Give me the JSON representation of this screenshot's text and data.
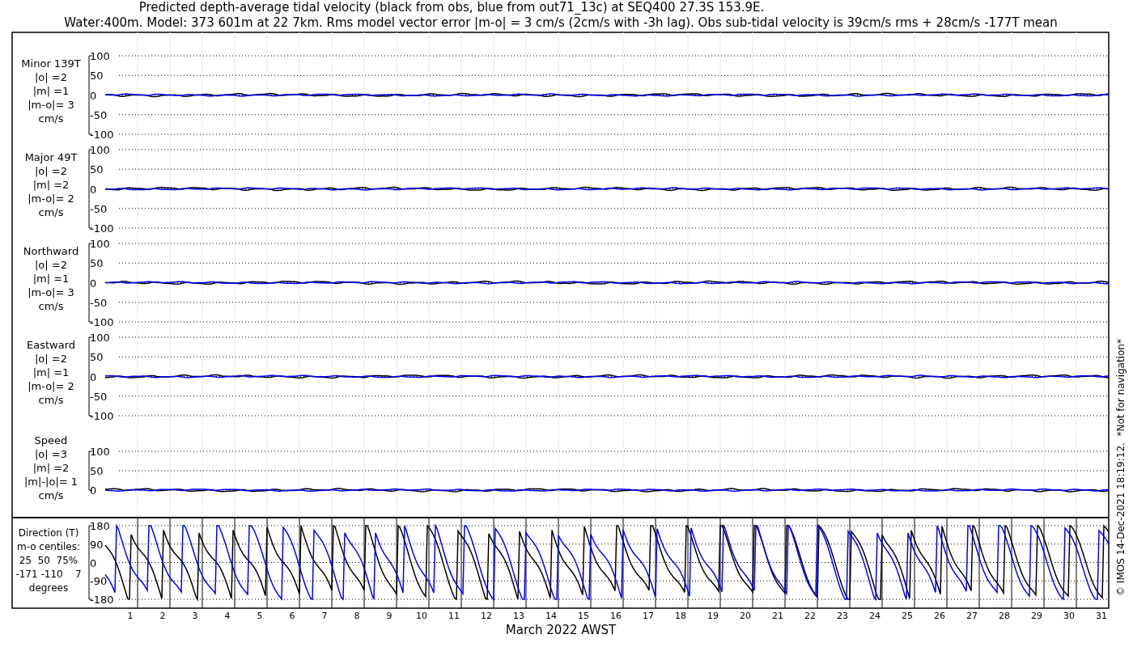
{
  "title_lines": [
    "Predicted depth-average tidal velocity (black from obs, blue from out71_13c) at SEQ400 27.3S 153.9E.",
    "Water:400m. Model: 373 601m at 22 7km. Rms model vector error |m-o| = 3 cm/s (2cm/s with -3h lag). Obs sub-tidal velocity is 39cm/s rms + 28cm/s -177T mean"
  ],
  "panels": [
    {
      "kind": "velocity",
      "label_lines": [
        "Minor 139T",
        "|o| =2",
        "|m| =1",
        "|m-o|= 3",
        "cm/s"
      ],
      "yticks": [
        "100",
        "50",
        "0",
        "-50",
        "-100"
      ]
    },
    {
      "kind": "velocity",
      "label_lines": [
        "Major 49T",
        "|o| =2",
        "|m| =2",
        "|m-o|= 2",
        "cm/s"
      ],
      "yticks": [
        "100",
        "50",
        "0",
        "-50",
        "-100"
      ]
    },
    {
      "kind": "velocity",
      "label_lines": [
        "Northward",
        "|o| =2",
        "|m| =1",
        "|m-o|= 3",
        "cm/s"
      ],
      "yticks": [
        "100",
        "50",
        "0",
        "-50",
        "-100"
      ]
    },
    {
      "kind": "velocity",
      "label_lines": [
        "Eastward",
        "|o| =2",
        "|m| =1",
        "|m-o|= 2",
        "cm/s"
      ],
      "yticks": [
        "100",
        "50",
        "0",
        "-50",
        "-100"
      ]
    },
    {
      "kind": "speed",
      "label_lines": [
        "Speed",
        "|o| =3",
        "|m| =2",
        "|m|-|o|= 1",
        "cm/s"
      ],
      "yticks": [
        "100",
        "50",
        "0"
      ]
    },
    {
      "kind": "direction",
      "label_lines": [
        "Direction (T)",
        "m-o centiles:",
        "25  50  75%",
        "-171 -110    7",
        "degrees"
      ],
      "yticks": [
        "180",
        "90",
        "0",
        "-90",
        "-180"
      ]
    }
  ],
  "xticks": [
    "1",
    "2",
    "3",
    "4",
    "5",
    "6",
    "7",
    "8",
    "9",
    "10",
    "11",
    "12",
    "13",
    "14",
    "15",
    "16",
    "17",
    "18",
    "19",
    "20",
    "21",
    "22",
    "23",
    "24",
    "25",
    "26",
    "27",
    "28",
    "29",
    "30",
    "31"
  ],
  "xlabel": "March 2022 AWST",
  "footer": "© IMOS 14-Dec-2021 18:19:12.  *Not for navigation*"
}
